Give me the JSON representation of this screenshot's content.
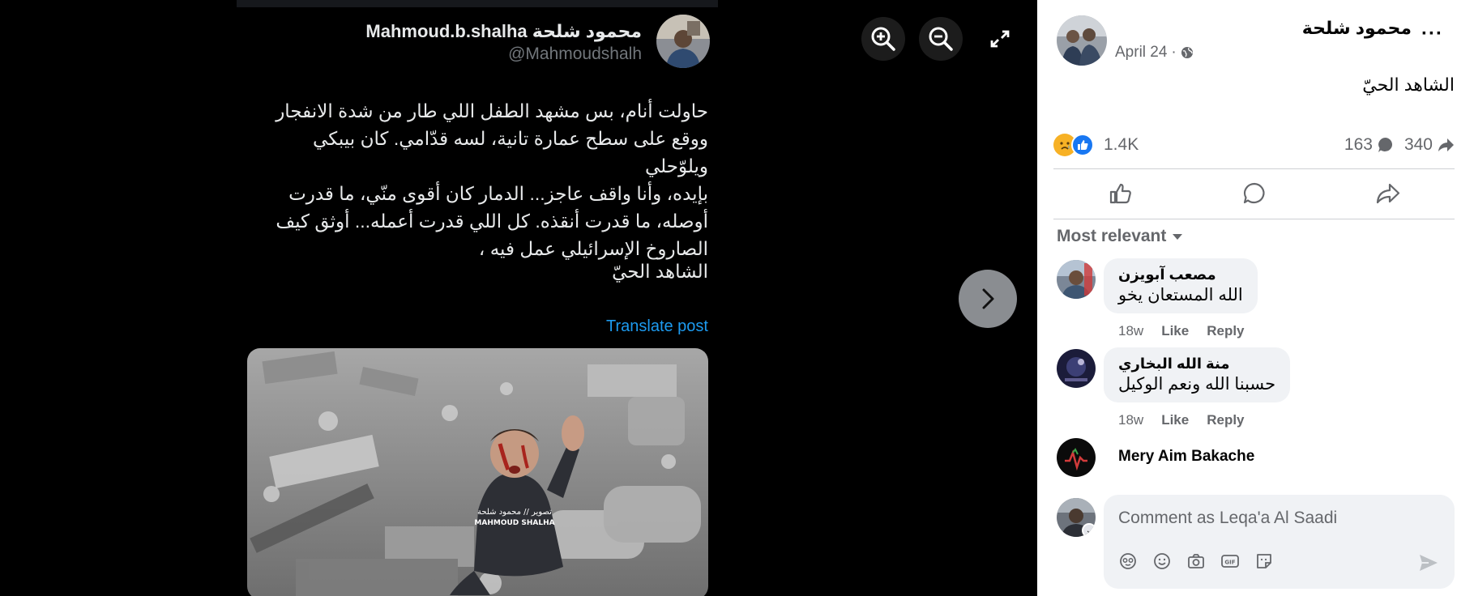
{
  "viewer": {
    "controls": {
      "zoom_in": "zoom-in-icon",
      "zoom_out": "zoom-out-icon",
      "fullscreen": "fullscreen-icon",
      "next": "chevron-right-icon"
    },
    "tweet": {
      "name": "Mahmoud.b.shalha محمود شلحة",
      "handle": "@Mahmoudshalh",
      "body": "حاولت أنام، بس مشهد الطفل اللي طار من شدة الانفجار\nووقع على سطح عمارة تانية، لسه قدّامي. كان بيبكي ويلوّحلي\nبإيده، وأنا واقف عاجز... الدمار كان أقوى منّي، ما قدرت\nأوصله، ما قدرت أنقذه. كل اللي قدرت أعمله... أوثق كيف\nالصاروخ الإسرائيلي عمل فيه ،",
      "tagline": "الشاهد الحيّ",
      "translate": "Translate post",
      "watermark_ar": "تصوير // محمود شلحة",
      "watermark_en": "MAHMOUD SHALHA"
    }
  },
  "post": {
    "author": "محمود شلحة",
    "date": "April 24",
    "separator": "·",
    "text": "الشاهد الحيّ",
    "reactions_count": "1.4K",
    "comments_count": "163",
    "shares_count": "340"
  },
  "comments_section": {
    "sort_label": "Most relevant",
    "comments": [
      {
        "name": "مصعب آبويزن",
        "text": "الله المستعان يخو",
        "time": "18w",
        "like": "Like",
        "reply": "Reply"
      },
      {
        "name": "منة الله البخاري",
        "text": "حسبنا الله ونعم الوكيل",
        "time": "18w",
        "like": "Like",
        "reply": "Reply"
      },
      {
        "name": "Mery Aim Bakache"
      }
    ]
  },
  "composer": {
    "placeholder": "Comment as Leqa'a Al Saadi"
  },
  "colors": {
    "viewer_bg": "#000000",
    "link_blue": "#1d9bf0",
    "fb_blue": "#1877f2",
    "muted": "#65676b"
  }
}
